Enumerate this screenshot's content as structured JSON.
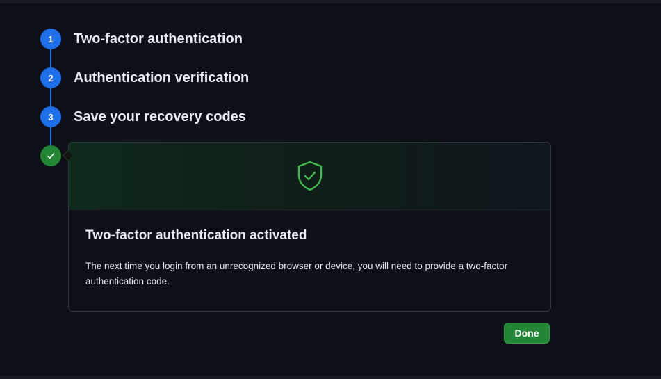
{
  "steps": [
    {
      "number": "1",
      "title": "Two-factor authentication"
    },
    {
      "number": "2",
      "title": "Authentication verification"
    },
    {
      "number": "3",
      "title": "Save your recovery codes"
    }
  ],
  "final_step": {
    "icon": "check-icon",
    "card": {
      "icon": "shield-check-icon",
      "title": "Two-factor authentication activated",
      "message": "The next time you login from an unrecognized browser or device, you will need to provide a two-factor authentication code."
    }
  },
  "actions": {
    "done_label": "Done"
  },
  "colors": {
    "background": "#0d1117",
    "step_accent": "#1f6feb",
    "success": "#238636",
    "shield": "#3fb950"
  }
}
